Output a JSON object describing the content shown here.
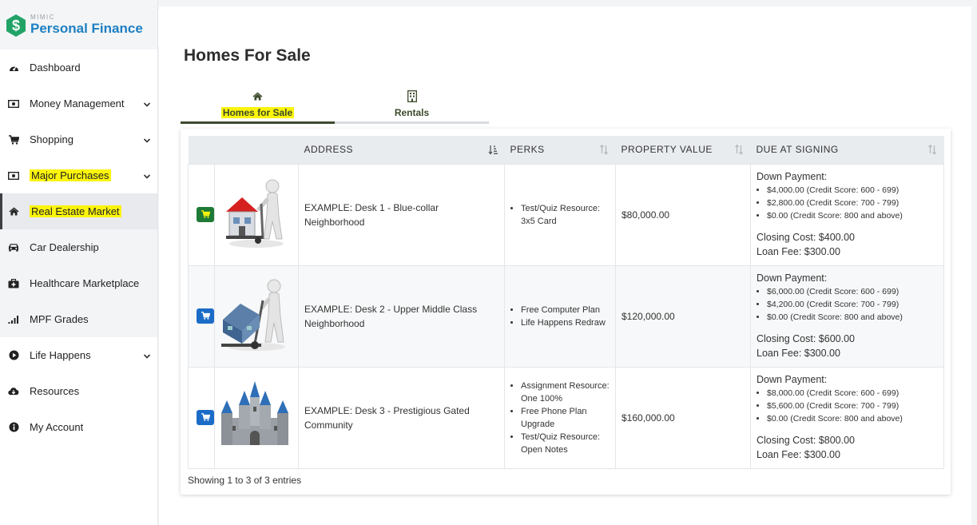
{
  "brand": {
    "small": "MIMIC",
    "name": "Personal Finance"
  },
  "sidebar": {
    "items": [
      {
        "label": "Dashboard",
        "icon": "dashboard-icon"
      },
      {
        "label": "Money Management",
        "icon": "money-icon",
        "expandable": true
      },
      {
        "label": "Shopping",
        "icon": "cart-icon",
        "expandable": true
      },
      {
        "label": "Major Purchases",
        "icon": "money-icon",
        "expandable": true,
        "highlighted": true
      },
      {
        "label": "Real Estate Market",
        "icon": "home-icon",
        "active": true,
        "highlighted": true
      },
      {
        "label": "Car Dealership",
        "icon": "car-icon"
      },
      {
        "label": "Healthcare Marketplace",
        "icon": "medkit-icon"
      },
      {
        "label": "MPF Grades",
        "icon": "signal-icon"
      },
      {
        "label": "Life Happens",
        "icon": "play-circle-icon",
        "expandable": true
      },
      {
        "label": "Resources",
        "icon": "cloud-download-icon"
      },
      {
        "label": "My Account",
        "icon": "info-circle-icon"
      }
    ]
  },
  "page": {
    "title": "Homes For Sale"
  },
  "tabs": [
    {
      "label": "Homes for Sale",
      "icon": "home-icon",
      "active": true
    },
    {
      "label": "Rentals",
      "icon": "building-icon",
      "active": false
    }
  ],
  "table": {
    "columns": [
      "",
      "",
      "ADDRESS",
      "PERKS",
      "PROPERTY VALUE",
      "DUE AT SIGNING"
    ],
    "rows": [
      {
        "address": "EXAMPLE: Desk 1 - Blue-collar Neighborhood",
        "perks": [
          "Test/Quiz Resource: 3x5 Card"
        ],
        "value": "$80,000.00",
        "down_label": "Down Payment:",
        "down": [
          {
            "amount": "$4,000.00",
            "note": "(Credit Score: 600 - 699)"
          },
          {
            "amount": "$2,800.00",
            "note": "(Credit Score: 700 - 799)"
          },
          {
            "amount": "$0.00",
            "note": "(Credit Score: 800 and above)"
          }
        ],
        "closing": "Closing Cost: $400.00",
        "loan": "Loan Fee: $300.00",
        "selected": true
      },
      {
        "address": "EXAMPLE: Desk 2 - Upper Middle Class Neighborhood",
        "perks": [
          "Free Computer Plan",
          "Life Happens Redraw"
        ],
        "value": "$120,000.00",
        "down_label": "Down Payment:",
        "down": [
          {
            "amount": "$6,000.00",
            "note": "(Credit Score: 600 - 699)"
          },
          {
            "amount": "$4,200.00",
            "note": "(Credit Score: 700 - 799)"
          },
          {
            "amount": "$0.00",
            "note": "(Credit Score: 800 and above)"
          }
        ],
        "closing": "Closing Cost: $600.00",
        "loan": "Loan Fee: $300.00",
        "selected": false
      },
      {
        "address": "EXAMPLE: Desk 3 - Prestigious Gated Community",
        "perks": [
          "Assignment Resource: One 100%",
          "Free Phone Plan Upgrade",
          "Test/Quiz Resource: Open Notes"
        ],
        "value": "$160,000.00",
        "down_label": "Down Payment:",
        "down": [
          {
            "amount": "$8,000.00",
            "note": "(Credit Score: 600 - 699)"
          },
          {
            "amount": "$5,600.00",
            "note": "(Credit Score: 700 - 799)"
          },
          {
            "amount": "$0.00",
            "note": "(Credit Score: 800 and above)"
          }
        ],
        "closing": "Closing Cost: $800.00",
        "loan": "Loan Fee: $300.00",
        "selected": false
      }
    ],
    "footer": "Showing 1 to 3 of 3 entries"
  },
  "colors": {
    "brand_blue": "#1e7fc2",
    "brand_green": "#21a366",
    "highlight": "#fbf40c",
    "cart_blue": "#1b6cc7",
    "cart_selected": "#1e7a34"
  }
}
